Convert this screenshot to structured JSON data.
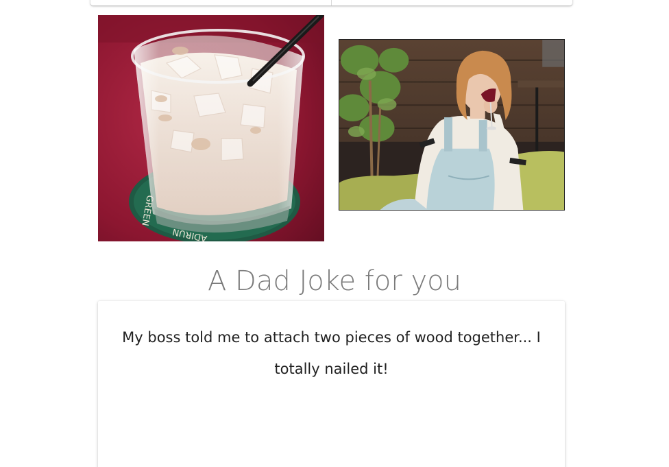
{
  "images": {
    "drink_photo": {
      "alt": "Iced milky drink in a glass with a black straw on a green coaster"
    },
    "reaction_gif": {
      "alt": "Woman in overalls sipping red wine on a green couch"
    }
  },
  "joke_section": {
    "heading": "A Dad Joke for you",
    "joke_text": "My boss told me to attach two pieces of wood together... I totally nailed it!"
  }
}
